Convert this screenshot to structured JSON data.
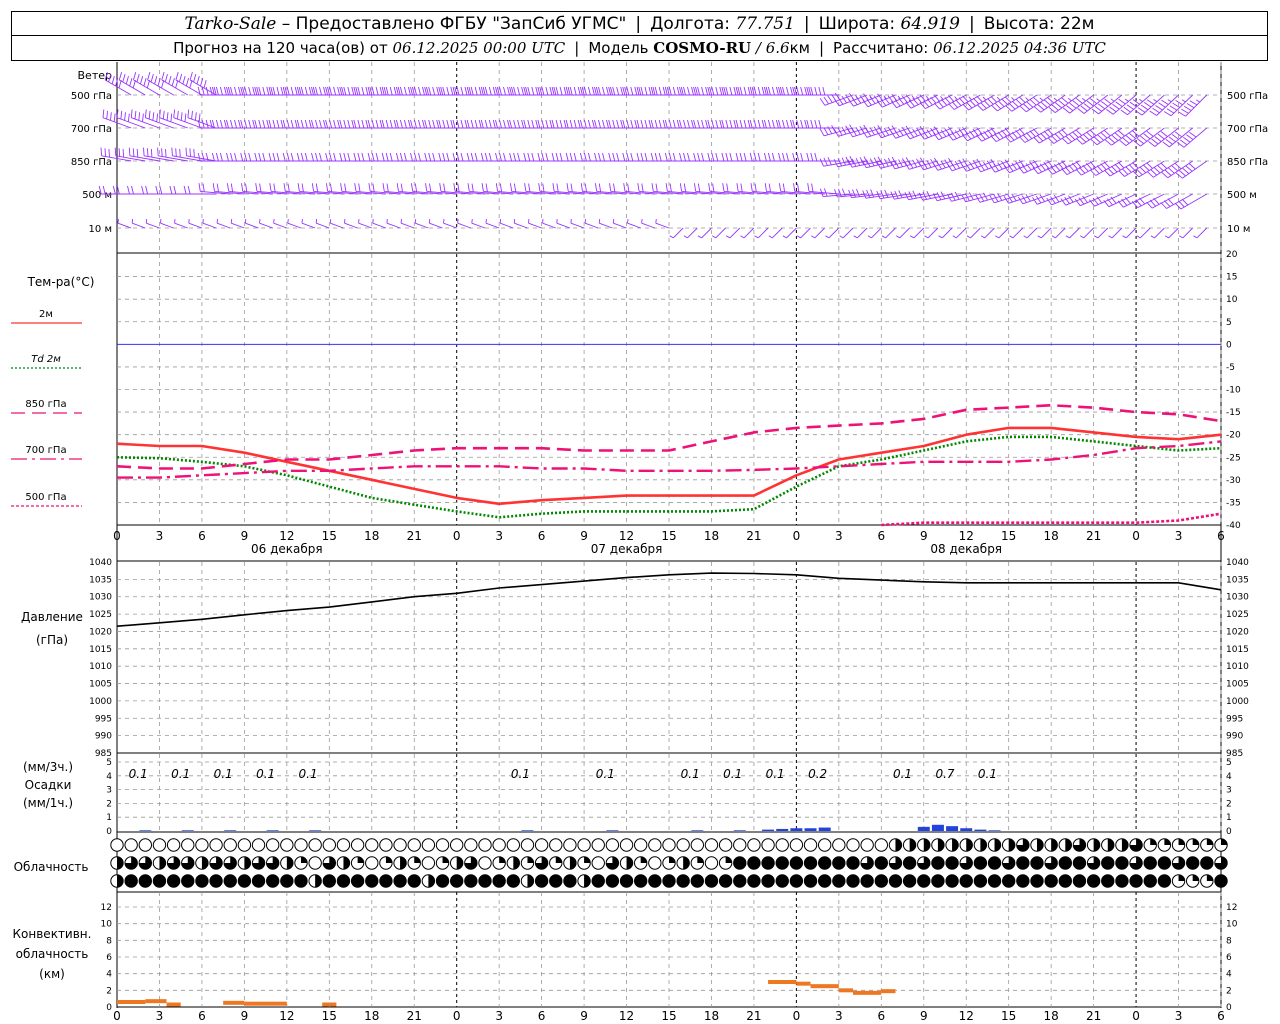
{
  "header": {
    "station": "Tarko-Sale",
    "provider": "– Предоставлено ФГБУ \"ЗапСиб УГМС\"",
    "lon_label": "Долгота:",
    "lon_value": "77.751",
    "lat_label": "Широта:",
    "lat_value": "64.919",
    "alt_label": "Высота:",
    "alt_value": "22м",
    "forecast_prefix": "Прогноз на 120 часа(ов) от",
    "forecast_time": "06.12.2025 00:00 UTC",
    "model_label": "Модель",
    "model_name": "COSMO-RU",
    "model_res": "/ 6.6",
    "model_unit": "км",
    "calc_label": "Рассчитано:",
    "calc_time": "06.12.2025 04:36 UTC"
  },
  "colors": {
    "wind": "#9933ff",
    "t2m": "#ff3333",
    "td2m": "#008800",
    "t850": "#ee1177",
    "t700": "#ee1177",
    "t500": "#ee1177",
    "zero_line": "#3333ff",
    "pressure": "#000000",
    "precip_bar": "#2244dd",
    "convective": "#ee7722",
    "grid": "#999999"
  },
  "chart_data": [
    {
      "type": "barbs",
      "panel": "wind",
      "title": "Ветер",
      "levels": [
        "500 гПа",
        "700 гПа",
        "850 гПа",
        "500 м",
        "10 м"
      ],
      "x_ticks": [
        "0",
        "3",
        "6",
        "9",
        "12",
        "15",
        "18",
        "21",
        "0",
        "3",
        "6",
        "9",
        "12",
        "15",
        "18",
        "21",
        "0",
        "3",
        "6",
        "9",
        "12",
        "15",
        "18",
        "21",
        "0",
        "3",
        "6"
      ],
      "approx_speed_ms": [
        25,
        22,
        17,
        12,
        4
      ]
    },
    {
      "type": "line",
      "panel": "temperature",
      "title": "Тем-ра(°С)",
      "legend": [
        {
          "name": "2м",
          "style": "solid"
        },
        {
          "name": "Td  2м",
          "style": "dotted"
        },
        {
          "name": "850 гПа",
          "style": "dashed"
        },
        {
          "name": "700 гПа",
          "style": "dashdot"
        },
        {
          "name": "500 гПа",
          "style": "dashed-fine"
        }
      ],
      "ylim": [
        -40,
        20
      ],
      "y_ticks": [
        "20",
        "15",
        "10",
        "5",
        "0",
        "-5",
        "-10",
        "-15",
        "-20",
        "-25",
        "-30",
        "-35",
        "-40"
      ],
      "x": [
        0,
        3,
        6,
        9,
        12,
        15,
        18,
        21,
        24,
        27,
        30,
        33,
        36,
        39,
        42,
        45,
        48,
        51,
        54,
        57,
        60,
        63,
        66,
        69,
        72,
        75,
        78
      ],
      "x_ticks": [
        "0",
        "3",
        "6",
        "9",
        "12",
        "15",
        "18",
        "21",
        "0",
        "3",
        "6",
        "9",
        "12",
        "15",
        "18",
        "21",
        "0",
        "3",
        "6",
        "9",
        "12",
        "15",
        "18",
        "21",
        "0",
        "3",
        "6"
      ],
      "day_labels": [
        "06 декабря",
        "07 декабря",
        "08 декабря"
      ],
      "series": [
        {
          "name": "2м",
          "values": [
            -22,
            -22.5,
            -22.5,
            -24,
            -26,
            -28,
            -30,
            -32,
            -34,
            -35.3,
            -34.5,
            -34,
            -33.5,
            -33.5,
            -33.5,
            -33.5,
            -29,
            -25.5,
            -24,
            -22.5,
            -20,
            -18.5,
            -18.5,
            -19.5,
            -20.5,
            -21,
            -20
          ]
        },
        {
          "name": "Td  2м",
          "values": [
            -25,
            -25.2,
            -26,
            -27,
            -29,
            -31.5,
            -34,
            -35.5,
            -37,
            -38.3,
            -37.5,
            -37,
            -37,
            -37,
            -37,
            -36.5,
            -31.5,
            -27,
            -25.5,
            -23.5,
            -21.5,
            -20.5,
            -20.5,
            -21.5,
            -22.5,
            -23.5,
            -23
          ]
        },
        {
          "name": "850 гПа",
          "values": [
            -27,
            -27.5,
            -27.5,
            -26.5,
            -25.5,
            -25.5,
            -24.5,
            -23.5,
            -23,
            -23,
            -23,
            -23.5,
            -23.5,
            -23.5,
            -21.5,
            -19.5,
            -18.5,
            -18,
            -17.5,
            -16.5,
            -14.5,
            -14,
            -13.5,
            -14,
            -15,
            -15.5,
            -17
          ]
        },
        {
          "name": "700 гПа",
          "values": [
            -29.5,
            -29.5,
            -29,
            -28.5,
            -28,
            -28,
            -27.5,
            -27,
            -27,
            -27,
            -27.5,
            -27.5,
            -28,
            -28,
            -28,
            -27.8,
            -27.5,
            -27,
            -26.5,
            -26,
            -26,
            -26,
            -25.5,
            -24.5,
            -23,
            -22.5,
            -21.5
          ]
        },
        {
          "name": "500 гПа",
          "values": [
            null,
            null,
            null,
            null,
            null,
            null,
            null,
            null,
            null,
            null,
            null,
            null,
            null,
            null,
            null,
            null,
            null,
            null,
            -40,
            -39.5,
            -39.5,
            -39.5,
            -39.5,
            -39.5,
            -39.5,
            -39,
            -37.5
          ]
        }
      ]
    },
    {
      "type": "line",
      "panel": "pressure",
      "title": "Давление",
      "ylabel": "(гПа)",
      "ylim": [
        985,
        1040
      ],
      "y_ticks": [
        "1040",
        "1035",
        "1030",
        "1025",
        "1020",
        "1015",
        "1010",
        "1005",
        "1000",
        "995",
        "990",
        "985"
      ],
      "x": [
        0,
        3,
        6,
        9,
        12,
        15,
        18,
        21,
        24,
        27,
        30,
        33,
        36,
        39,
        42,
        45,
        48,
        51,
        54,
        57,
        60,
        63,
        66,
        69,
        72,
        75,
        78
      ],
      "series": [
        {
          "name": "Давление",
          "values": [
            1021.5,
            1022.5,
            1023.5,
            1024.8,
            1026,
            1027,
            1028.5,
            1030,
            1031,
            1032.5,
            1033.5,
            1034.5,
            1035.5,
            1036.3,
            1036.8,
            1036.7,
            1036.3,
            1035.3,
            1034.8,
            1034.3,
            1034,
            1034,
            1034,
            1034,
            1034,
            1034,
            1032
          ]
        }
      ]
    },
    {
      "type": "bar",
      "panel": "precipitation",
      "title": "Осадки",
      "units_3h": "(мм/3ч.)",
      "units_1h": "(мм/1ч.)",
      "ylim": [
        0,
        5
      ],
      "y_ticks": [
        "5",
        "4",
        "3",
        "2",
        "1",
        "0"
      ],
      "labels": [
        {
          "x": 1.5,
          "text": "0.1"
        },
        {
          "x": 4.5,
          "text": "0.1"
        },
        {
          "x": 7.5,
          "text": "0.1"
        },
        {
          "x": 10.5,
          "text": "0.1"
        },
        {
          "x": 13.5,
          "text": "0.1"
        },
        {
          "x": 28.5,
          "text": "0.1"
        },
        {
          "x": 34.5,
          "text": "0.1"
        },
        {
          "x": 40.5,
          "text": "0.1"
        },
        {
          "x": 43.5,
          "text": "0.1"
        },
        {
          "x": 46.5,
          "text": "0.1"
        },
        {
          "x": 49.5,
          "text": "0.2"
        },
        {
          "x": 55.5,
          "text": "0.1"
        },
        {
          "x": 58.5,
          "text": "0.7"
        },
        {
          "x": 61.5,
          "text": "0.1"
        }
      ],
      "bars": [
        {
          "x": 2,
          "v": 0.05
        },
        {
          "x": 5,
          "v": 0.05
        },
        {
          "x": 8,
          "v": 0.05
        },
        {
          "x": 11,
          "v": 0.05
        },
        {
          "x": 14,
          "v": 0.05
        },
        {
          "x": 29,
          "v": 0.05
        },
        {
          "x": 35,
          "v": 0.05
        },
        {
          "x": 41,
          "v": 0.05
        },
        {
          "x": 44,
          "v": 0.05
        },
        {
          "x": 46,
          "v": 0.1
        },
        {
          "x": 47,
          "v": 0.15
        },
        {
          "x": 48,
          "v": 0.2
        },
        {
          "x": 49,
          "v": 0.2
        },
        {
          "x": 50,
          "v": 0.25
        },
        {
          "x": 57,
          "v": 0.3
        },
        {
          "x": 58,
          "v": 0.45
        },
        {
          "x": 59,
          "v": 0.35
        },
        {
          "x": 60,
          "v": 0.2
        },
        {
          "x": 61,
          "v": 0.1
        },
        {
          "x": 62,
          "v": 0.05
        }
      ]
    },
    {
      "type": "symbols",
      "panel": "cloudiness",
      "title": "Облачность",
      "rows": [
        "high",
        "middle",
        "low"
      ],
      "note": "Circle fill shows cloud amount per hour (0 = clear, 1 = overcast)"
    },
    {
      "type": "bar",
      "panel": "convective",
      "title": "Конвективн. облачность",
      "ylabel": "(км)",
      "ylim": [
        0,
        13
      ],
      "y_ticks": [
        "12",
        "10",
        "8",
        "6",
        "4",
        "2",
        "0"
      ],
      "segments": [
        {
          "x0": 0,
          "x1": 2,
          "v": 0.6
        },
        {
          "x0": 2,
          "x1": 3.5,
          "v": 0.7
        },
        {
          "x0": 3.5,
          "x1": 4.5,
          "v": 0.3
        },
        {
          "x0": 7.5,
          "x1": 9,
          "v": 0.5
        },
        {
          "x0": 9,
          "x1": 12,
          "v": 0.4
        },
        {
          "x0": 14.5,
          "x1": 15.5,
          "v": 0.3
        },
        {
          "x0": 46,
          "x1": 48,
          "v": 3.0
        },
        {
          "x0": 48,
          "x1": 49,
          "v": 2.8
        },
        {
          "x0": 49,
          "x1": 51,
          "v": 2.5
        },
        {
          "x0": 51,
          "x1": 52,
          "v": 2.0
        },
        {
          "x0": 52,
          "x1": 54,
          "v": 1.7
        },
        {
          "x0": 54,
          "x1": 55,
          "v": 1.9
        }
      ]
    }
  ]
}
